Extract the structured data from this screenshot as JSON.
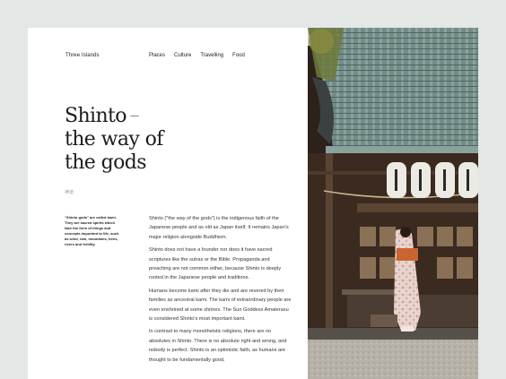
{
  "nav": {
    "brand": "Three Islands",
    "links": [
      "Places",
      "Culture",
      "Travelling",
      "Food"
    ]
  },
  "hero": {
    "line1": "Shinto",
    "dash": "—",
    "line2": "the way of",
    "line3": "the gods"
  },
  "kanji": "神道",
  "sidenote": "\"Shinto gods\" are called kami. They are sacred spirits which take the form of things and concepts important to life, such as wind, rain, mountains, trees, rivers and fertility.",
  "paragraphs": [
    "Shinto (\"the way of the gods\") is the indigenous faith of the Japanese people and as old as Japan itself. It remains Japan's major religion alongside Buddhism.",
    "Shinto does not have a founder nor does it have sacred scriptures like the sutras or the Bible. Propaganda and preaching are not common either, because Shinto is deeply rooted in the Japanese people and traditions.",
    "Humans become kami after they die and are revered by their families as ancestral kami. The kami of extraordinary people are even enshrined at some shrines. The Sun Goddess Amaterasu is considered Shinto's most important kami.",
    "In contrast to many monotheistic religions, there are no absolutes in Shinto. There is no absolute right and wrong, and nobody is perfect. Shinto is an optimistic faith, as humans are thought to be fundamentally good,"
  ],
  "colors": {
    "background": "#e3e7e6",
    "roof": "#6f8b87",
    "wood": "#3a2a20",
    "kimono": "#e8c9c0",
    "obi": "#c9652e"
  }
}
